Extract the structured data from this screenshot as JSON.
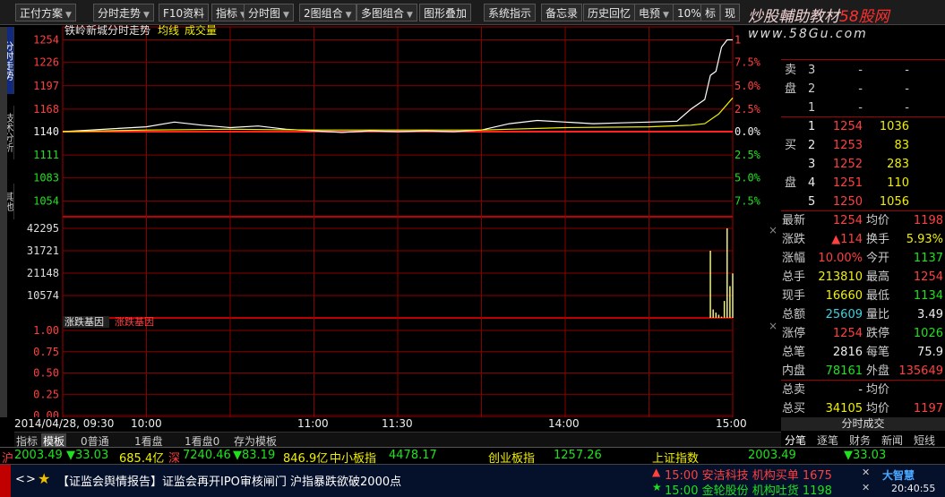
{
  "menu": {
    "items": [
      {
        "label": "正付方案",
        "arrow": true
      },
      {
        "label": "分时走势",
        "arrow": true
      },
      {
        "label": "F10资料",
        "arrow": false
      },
      {
        "label": "指标",
        "arrow": true
      },
      {
        "label": "分时图",
        "arrow": true
      },
      {
        "label": "2图组合",
        "arrow": true
      },
      {
        "label": "多图组合",
        "arrow": true
      },
      {
        "label": "图形叠加",
        "arrow": false
      },
      {
        "label": "系统指示",
        "arrow": false
      },
      {
        "label": "备忘录",
        "arrow": false
      },
      {
        "label": "历史回忆",
        "arrow": false
      },
      {
        "label": "电预",
        "arrow": true
      },
      {
        "label": "10%",
        "arrow": false
      },
      {
        "label": "标",
        "arrow": false
      },
      {
        "label": "现",
        "arrow": false
      }
    ],
    "watermark": "炒股輔助教材",
    "watermark_red": "58股网",
    "watermark_url": "www.58Gu.com"
  },
  "left_tabs": [
    "分时走势",
    "技术分析",
    "其他"
  ],
  "chart_data": {
    "type": "line",
    "title": "铁岭新城分时走势",
    "legend": [
      "均线",
      "成交量"
    ],
    "price_axis": {
      "ticks": [
        1254,
        1226,
        1197,
        1168,
        1140,
        1111,
        1083,
        1054
      ],
      "base": 1140
    },
    "pct_axis": {
      "ticks": [
        "1",
        "7.5%",
        "5.0%",
        "2.5%",
        "0.0%",
        "2.5%",
        "5.0%",
        "7.5%"
      ]
    },
    "volume_axis": {
      "ticks": [
        42295,
        31721,
        21148,
        10574
      ]
    },
    "indicator": {
      "title": "涨跌基因",
      "tab": "涨跌基因",
      "ticks": [
        "1.00",
        "0.75",
        "0.50",
        "0.25",
        "0.00"
      ]
    },
    "time_axis": {
      "start": "2014/04/28, 09:30",
      "labels": [
        "10:00",
        "11:00",
        "11:30",
        "14:00",
        "15:00"
      ]
    },
    "price_series": [
      [
        "09:30",
        1140
      ],
      [
        "09:40",
        1142
      ],
      [
        "09:50",
        1144
      ],
      [
        "10:00",
        1146
      ],
      [
        "10:10",
        1152
      ],
      [
        "10:20",
        1148
      ],
      [
        "10:30",
        1145
      ],
      [
        "10:40",
        1147
      ],
      [
        "10:50",
        1143
      ],
      [
        "11:00",
        1141
      ],
      [
        "11:10",
        1139
      ],
      [
        "11:20",
        1141
      ],
      [
        "11:30",
        1140
      ],
      [
        "13:10",
        1141
      ],
      [
        "13:20",
        1140
      ],
      [
        "13:30",
        1142
      ],
      [
        "13:40",
        1150
      ],
      [
        "13:50",
        1154
      ],
      [
        "14:00",
        1152
      ],
      [
        "14:10",
        1150
      ],
      [
        "14:20",
        1151
      ],
      [
        "14:30",
        1152
      ],
      [
        "14:40",
        1153
      ],
      [
        "14:45",
        1168
      ],
      [
        "14:50",
        1180
      ],
      [
        "14:52",
        1210
      ],
      [
        "14:54",
        1215
      ],
      [
        "14:56",
        1245
      ],
      [
        "14:58",
        1254
      ],
      [
        "15:00",
        1254
      ]
    ],
    "avg_series": [
      [
        "09:30",
        1140
      ],
      [
        "10:00",
        1142
      ],
      [
        "10:30",
        1143
      ],
      [
        "11:00",
        1142
      ],
      [
        "11:30",
        1142
      ],
      [
        "13:30",
        1142
      ],
      [
        "14:00",
        1145
      ],
      [
        "14:30",
        1146
      ],
      [
        "14:45",
        1148
      ],
      [
        "14:50",
        1150
      ],
      [
        "14:55",
        1162
      ],
      [
        "15:00",
        1182
      ]
    ],
    "volume_bars": [
      [
        "14:50",
        3
      ],
      [
        "14:51",
        5
      ],
      [
        "14:52",
        31721
      ],
      [
        "14:53",
        4000
      ],
      [
        "14:54",
        2500
      ],
      [
        "14:55",
        1500
      ],
      [
        "14:56",
        600
      ],
      [
        "14:57",
        8000
      ],
      [
        "14:58",
        42295
      ],
      [
        "14:59",
        15000
      ],
      [
        "15:00",
        21000
      ]
    ]
  },
  "quote": {
    "sell": [
      {
        "label": "卖",
        "idx": "3",
        "price": "-",
        "vol": "-"
      },
      {
        "label": "盘",
        "idx": "2",
        "price": "-",
        "vol": "-"
      },
      {
        "label": "",
        "idx": "1",
        "price": "-",
        "vol": "-"
      }
    ],
    "buy": [
      {
        "label": "",
        "idx": "1",
        "price": "1254",
        "vol": "1036"
      },
      {
        "label": "买",
        "idx": "2",
        "price": "1253",
        "vol": "83"
      },
      {
        "label": "",
        "idx": "3",
        "price": "1252",
        "vol": "283"
      },
      {
        "label": "盘",
        "idx": "4",
        "price": "1251",
        "vol": "110"
      },
      {
        "label": "",
        "idx": "5",
        "price": "1250",
        "vol": "1056"
      }
    ],
    "stats": [
      {
        "l1": "最新",
        "v1": "1254",
        "c1": "red",
        "l2": "均价",
        "v2": "1198",
        "c2": "red"
      },
      {
        "l1": "涨跌",
        "v1": "▲114",
        "c1": "red",
        "l2": "换手",
        "v2": "5.93%",
        "c2": "yel"
      },
      {
        "l1": "涨幅",
        "v1": "10.00%",
        "c1": "red",
        "l2": "今开",
        "v2": "1137",
        "c2": "green"
      },
      {
        "l1": "总手",
        "v1": "213810",
        "c1": "yel",
        "l2": "最高",
        "v2": "1254",
        "c2": "red"
      },
      {
        "l1": "现手",
        "v1": "16660",
        "c1": "yel",
        "l2": "最低",
        "v2": "1134",
        "c2": "green"
      },
      {
        "l1": "总额",
        "v1": "25609",
        "c1": "cyan",
        "l2": "量比",
        "v2": "3.49",
        "c2": "white"
      },
      {
        "l1": "涨停",
        "v1": "1254",
        "c1": "red",
        "l2": "跌停",
        "v2": "1026",
        "c2": "green"
      },
      {
        "l1": "总笔",
        "v1": "2816",
        "c1": "white",
        "l2": "每笔",
        "v2": "75.9",
        "c2": "white"
      },
      {
        "l1": "内盘",
        "v1": "78161",
        "c1": "green",
        "l2": "外盘",
        "v2": "135649",
        "c2": "red"
      },
      {
        "l1": "总卖",
        "v1": "-",
        "c1": "white",
        "l2": "均价",
        "v2": "",
        "c2": "white"
      },
      {
        "l1": "总买",
        "v1": "34105",
        "c1": "yel",
        "l2": "均价",
        "v2": "1197",
        "c2": "red"
      }
    ],
    "footer": "分时成交",
    "tabs": [
      "分笔",
      "逐笔",
      "财务",
      "新闻",
      "短线"
    ]
  },
  "subtabs": [
    "指标",
    "模板",
    "0普通",
    "1看盘",
    "1看盘0",
    "存为模板"
  ],
  "ticker": {
    "sh_label": "沪",
    "sh_val": "2003.49",
    "sh_chg": "▼33.03",
    "sh_amt": "685.4亿",
    "sz_label": "深",
    "sz_val": "7240.46",
    "sz_chg": "▼83.19",
    "sz_amt": "846.9亿",
    "zx_label": "中小板指",
    "zx_val": "4478.17",
    "cy_label": "创业板指",
    "cy_val": "1257.26",
    "idx_label": "上证指数",
    "idx_val": "2003.49",
    "idx_chg": "▼33.03"
  },
  "news": {
    "headline": "【证监会舆情报告】证监会再开IPO审核闸门 沪指暴跌欲破2000点",
    "alert1": "15:00 安洁科技 机构买单 1675",
    "alert2": "15:00 金轮股份 机构吐货 1198",
    "logo": "大智慧",
    "clock": "20:40:55"
  },
  "colors": {
    "up": "#ff4040",
    "down": "#20e020",
    "price_line": "#ffffff",
    "avg_line": "#f0f000",
    "grid": "#a00000"
  }
}
